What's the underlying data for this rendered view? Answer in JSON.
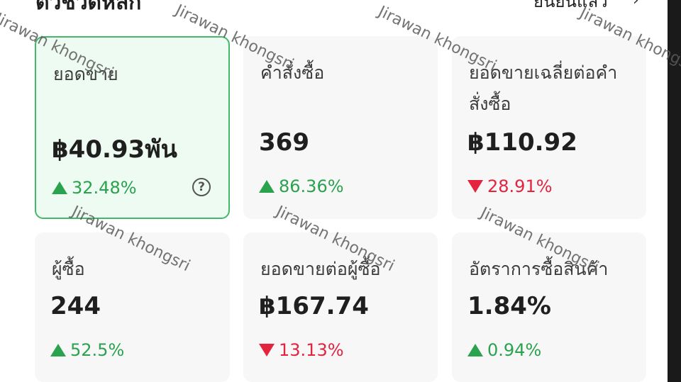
{
  "header": {
    "title": "ตัวชี้วัดหลัก",
    "link": "ยืนยันแล้ว",
    "chevron": "›"
  },
  "cards": [
    {
      "label": "ยอดขาย",
      "value": "฿40.93พัน",
      "change": "32.48%",
      "direction": "up",
      "selected": true,
      "help": "?"
    },
    {
      "label": "คำสั่งซื้อ",
      "value": "369",
      "change": "86.36%",
      "direction": "up"
    },
    {
      "label": "ยอดขายเฉลี่ยต่อคำสั่งซื้อ",
      "value": "฿110.92",
      "change": "28.91%",
      "direction": "down"
    },
    {
      "label": "ผู้ซื้อ",
      "value": "244",
      "change": "52.5%",
      "direction": "up"
    },
    {
      "label": "ยอดขายต่อผู้ซื้อ",
      "value": "฿167.74",
      "change": "13.13%",
      "direction": "down"
    },
    {
      "label": "อัตราการซื้อสินค้า",
      "value": "1.84%",
      "change": "0.94%",
      "direction": "up"
    }
  ],
  "watermark": "Jirawan khongsri",
  "colors": {
    "up": "#2aa24e",
    "down": "#e4233f",
    "selected_border": "#43b866",
    "selected_bg": "#eefbf2",
    "card_bg": "#f7f7f7"
  }
}
